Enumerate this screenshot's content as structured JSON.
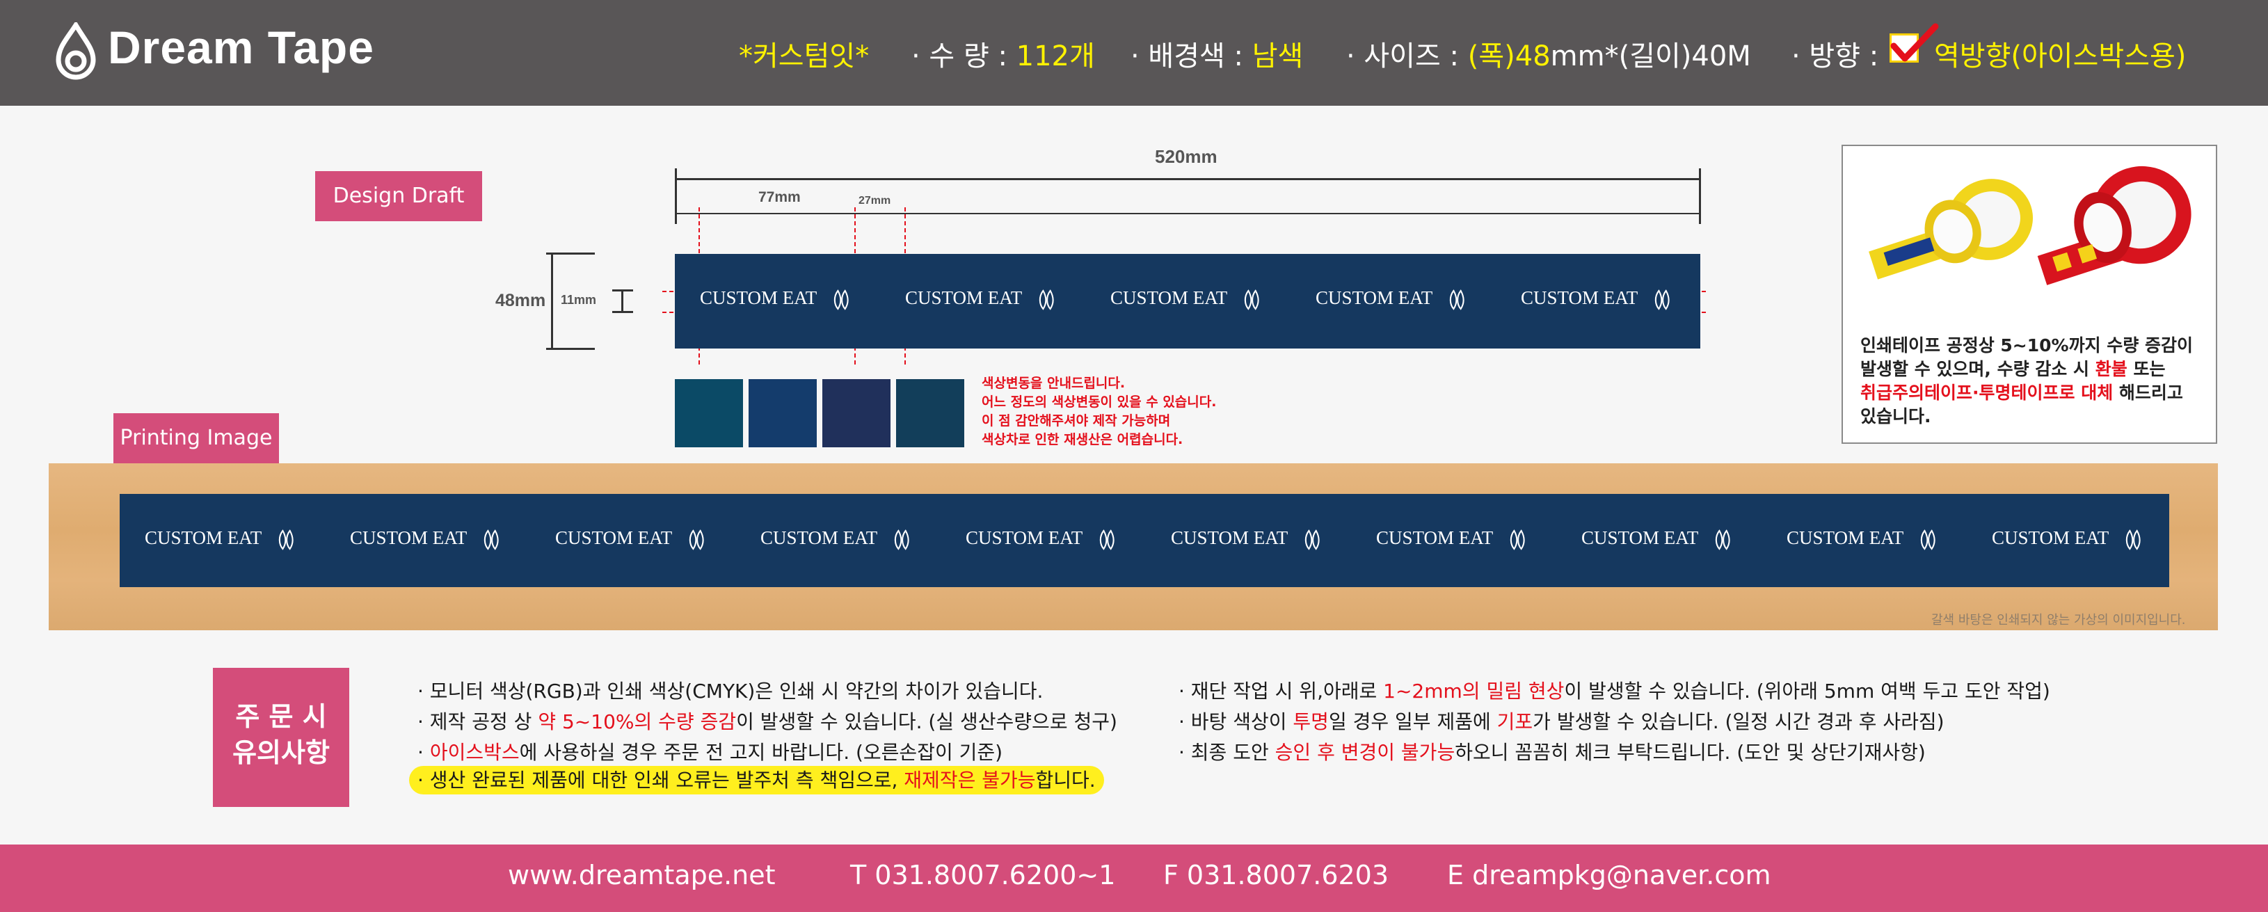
{
  "header": {
    "brand": "Dream Tape",
    "custom_label": "*커스텀잇*",
    "qty_label": "· 수 량 : ",
    "qty_value": "112개",
    "bg_label": "· 배경색 : ",
    "bg_value": "남색",
    "size_label": "· 사이즈 : ",
    "size_w_label": "(폭)",
    "size_w_value": "48",
    "size_rest": "mm*(길이)40M",
    "dir_label": "· 방향 : ",
    "dir_value": "역방향(아이스박스용)"
  },
  "labels": {
    "design_draft": "Design Draft",
    "printing_image": "Printing Image"
  },
  "dimensions": {
    "total_length": "520mm",
    "repeat": "77mm",
    "gap": "27mm",
    "width": "48mm",
    "text_height": "11mm"
  },
  "tape": {
    "text": "CUSTOM EAT",
    "draft_repeats": 5,
    "print_repeats": 10
  },
  "swatches": [
    "#0b4a66",
    "#143c6c",
    "#20305b",
    "#123e5a"
  ],
  "color_notice": [
    "색상변동을 안내드립니다.",
    "어느 정도의 색상변동이 있을 수 있습니다.",
    "이 점 감안해주셔야 제작 가능하며",
    "색상차로 인한 재생산은 어렵습니다."
  ],
  "sample_box": {
    "line1": "인쇄테이프 공정상 5~10%까지 수량 증감이",
    "line2_a": "발생할 수 있으며, 수량 감소 시 ",
    "line2_red": "환불",
    "line2_b": " 또는",
    "line3_red": "취급주의테이프·투명테이프로 대체",
    "line3_b": " 해드리고",
    "line4": "있습니다."
  },
  "wood_caption": "갈색 바탕은 인쇄되지 않는 가상의 이미지입니다.",
  "notes": {
    "badge_line1": "주 문 시",
    "badge_line2": "유의사항",
    "left": [
      {
        "a": "· 모니터 색상(RGB)과 인쇄 색상(CMYK)은 인쇄 시 약간의 차이가 있습니다.",
        "red": "",
        "b": ""
      },
      {
        "a": "· 제작 공정 상 ",
        "red": "약 5~10%의 수량 증감",
        "b": "이 발생할 수 있습니다. (실 생산수량으로 청구)"
      },
      {
        "a": "· ",
        "red": "아이스박스",
        "b": "에 사용하실 경우 주문 전 고지 바랍니다. (오른손잡이 기준)"
      }
    ],
    "highlight_a": "· 생산 완료된 제품에 대한 인쇄 오류는 발주처 측 책임으로, ",
    "highlight_red": "재제작은 불가능",
    "highlight_b": "합니다.",
    "right": [
      {
        "a": "· 재단 작업 시 위,아래로 ",
        "red": "1~2mm의 밀림 현상",
        "b": "이 발생할 수 있습니다. (위아래 5mm 여백 두고 도안 작업)"
      },
      {
        "a": "· 바탕 색상이 ",
        "red": "투명",
        "b": "일 경우 일부 제품에 ",
        "red2": "기포",
        "c": "가 발생할 수 있습니다. (일정 시간 경과 후 사라짐)"
      },
      {
        "a": "· 최종 도안 ",
        "red": "승인 후 변경이 불가능",
        "b": "하오니 꼼꼼히 체크 부탁드립니다. (도안 및 상단기재사항)"
      }
    ]
  },
  "footer": {
    "website": "www.dreamtape.net",
    "tel": "T 031.8007.6200~1",
    "fax": "F 031.8007.6203",
    "email": "E dreampkg@naver.com"
  }
}
